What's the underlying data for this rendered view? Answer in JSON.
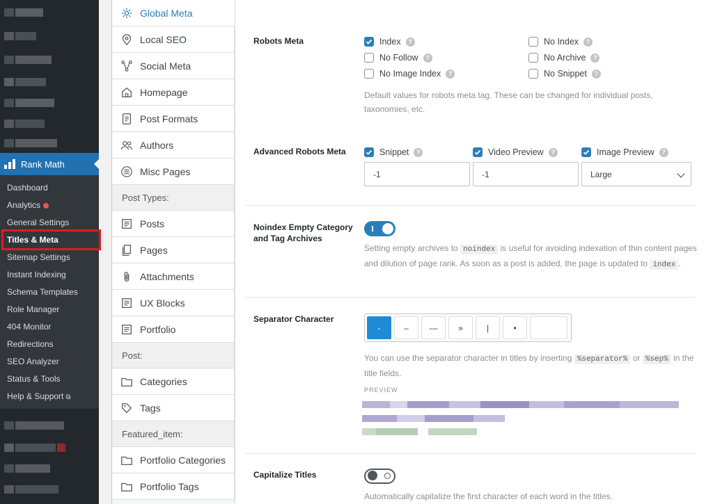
{
  "wp_menu": {
    "rank_math_label": "Rank Math",
    "submenu": [
      {
        "label": "Dashboard"
      },
      {
        "label": "Analytics",
        "badge": true
      },
      {
        "label": "General Settings"
      },
      {
        "label": "Titles & Meta",
        "current": true
      },
      {
        "label": "Sitemap Settings"
      },
      {
        "label": "Instant Indexing"
      },
      {
        "label": "Schema Templates"
      },
      {
        "label": "Role Manager"
      },
      {
        "label": "404 Monitor"
      },
      {
        "label": "Redirections"
      },
      {
        "label": "SEO Analyzer"
      },
      {
        "label": "Status & Tools"
      },
      {
        "label": "Help & Support",
        "external": true
      }
    ]
  },
  "settings_nav": {
    "items": [
      {
        "label": "Global Meta",
        "icon": "gear-icon",
        "active": true
      },
      {
        "label": "Local SEO",
        "icon": "map-pin-icon"
      },
      {
        "label": "Social Meta",
        "icon": "share-icon"
      },
      {
        "label": "Homepage",
        "icon": "home-icon"
      },
      {
        "label": "Post Formats",
        "icon": "document-icon"
      },
      {
        "label": "Authors",
        "icon": "users-icon"
      },
      {
        "label": "Misc Pages",
        "icon": "list-circle-icon"
      }
    ],
    "group_post_types": "Post Types:",
    "post_types": [
      {
        "label": "Posts",
        "icon": "post-icon"
      },
      {
        "label": "Pages",
        "icon": "pages-icon"
      },
      {
        "label": "Attachments",
        "icon": "paperclip-icon"
      },
      {
        "label": "UX Blocks",
        "icon": "post-icon"
      },
      {
        "label": "Portfolio",
        "icon": "post-icon"
      }
    ],
    "group_post": "Post:",
    "post_taxonomies": [
      {
        "label": "Categories",
        "icon": "folder-icon"
      },
      {
        "label": "Tags",
        "icon": "tag-icon"
      }
    ],
    "group_featured": "Featured_item:",
    "featured_taxonomies": [
      {
        "label": "Portfolio Categories",
        "icon": "folder-icon"
      },
      {
        "label": "Portfolio Tags",
        "icon": "folder-icon"
      }
    ]
  },
  "robots_meta": {
    "label": "Robots Meta",
    "options": [
      {
        "label": "Index",
        "checked": true
      },
      {
        "label": "No Index",
        "checked": false
      },
      {
        "label": "No Follow",
        "checked": false
      },
      {
        "label": "No Archive",
        "checked": false
      },
      {
        "label": "No Image Index",
        "checked": false
      },
      {
        "label": "No Snippet",
        "checked": false
      }
    ],
    "description": "Default values for robots meta tag. These can be changed for individual posts, taxonomies, etc."
  },
  "advanced_robots": {
    "label": "Advanced Robots Meta",
    "snippet_label": "Snippet",
    "snippet_value": "-1",
    "video_label": "Video Preview",
    "video_value": "-1",
    "image_label": "Image Preview",
    "image_value": "Large"
  },
  "noindex_empty": {
    "label": "Noindex Empty Category and Tag Archives",
    "enabled": true,
    "desc_1": "Setting empty archives to",
    "code_1": "noindex",
    "desc_2": "is useful for avoiding indexation of thin content pages and dilution of page rank. As soon as a post is added, the page is updated to",
    "code_2": "index",
    "desc_3": "."
  },
  "separator": {
    "label": "Separator Character",
    "options": [
      "-",
      "–",
      "—",
      "»",
      "|",
      "•"
    ],
    "selected_index": 0,
    "custom_value": "",
    "desc_1": "You can use the separator character in titles by inserting",
    "code_1": "%separator%",
    "desc_2": "or",
    "code_2": "%sep%",
    "desc_3": "in the title fields.",
    "preview_label": "PREVIEW"
  },
  "capitalize": {
    "label": "Capitalize Titles",
    "enabled": false,
    "description": "Automatically capitalize the first character of each word in the titles."
  },
  "colors": {
    "accent": "#2b7fb8",
    "wp_sidebar": "#23282d",
    "wp_active": "#2271b1",
    "highlight": "#e31b1b"
  }
}
